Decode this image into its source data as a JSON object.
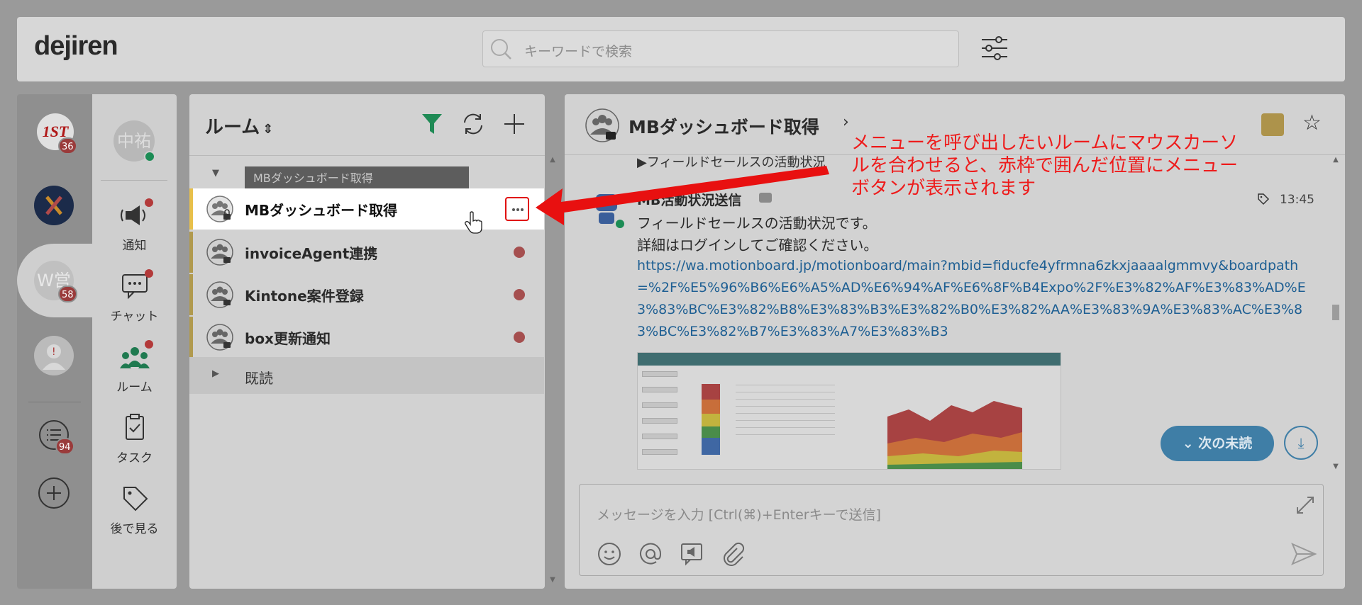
{
  "app": {
    "logo": "dejiren"
  },
  "search": {
    "placeholder": "キーワードで検索",
    "icon": "search-icon"
  },
  "workspaces": [
    {
      "label": "1ST",
      "badge": "36"
    },
    {
      "label": "X"
    },
    {
      "label": "W営",
      "badge": "58"
    },
    {
      "label": "!"
    },
    {
      "label": "list",
      "badge": "94"
    }
  ],
  "nav": {
    "avatar": "中祐",
    "items": [
      {
        "label": "通知",
        "icon": "megaphone-icon"
      },
      {
        "label": "チャット",
        "icon": "chat-icon"
      },
      {
        "label": "ルーム",
        "icon": "people-icon"
      },
      {
        "label": "タスク",
        "icon": "clipboard-check-icon"
      },
      {
        "label": "後で見る",
        "icon": "tag-icon"
      }
    ]
  },
  "rooms": {
    "title": "ルーム",
    "sort_icon": "⇕",
    "tooltip": "MBダッシュボード取得",
    "items": [
      {
        "name": "MBダッシュボード取得",
        "active": true
      },
      {
        "name": "invoiceAgent連携"
      },
      {
        "name": "Kintone案件登録"
      },
      {
        "name": "box更新通知"
      }
    ],
    "read_section": "既読"
  },
  "chat": {
    "title": "MBダッシュボード取得",
    "accent": "#ad934b",
    "previous": "▶フィールドセールスの活動状況",
    "message": {
      "sender": "MB活動状況送信",
      "time": "13:45",
      "lines": [
        "フィールドセールスの活動状況です。",
        "詳細はログインしてご確認ください。"
      ],
      "link": "https://wa.motionboard.jp/motionboard/main?mbid=fiducfe4yfrmna6zkxjaaaalgmmvy&boardpath=%2F%E5%96%B6%E6%A5%AD%E6%94%AF%E6%8F%B4Expo%2F%E3%82%AF%E3%83%AD%E3%83%BC%E3%82%B8%E3%83%B3%E3%82%B0%E3%82%AA%E3%83%9A%E3%83%AC%E3%83%BC%E3%82%B7%E3%83%A7%E3%83%B3"
    },
    "next_unread": "次の未読",
    "composer_placeholder": "メッセージを入力 [Ctrl(⌘)+Enterキーで送信]"
  },
  "annotation": {
    "text": "メニューを呼び出したいルームにマウスカーソルを合わせると、赤枠で囲んだ位置にメニューボタンが表示されます",
    "color": "#ee1b1b"
  }
}
